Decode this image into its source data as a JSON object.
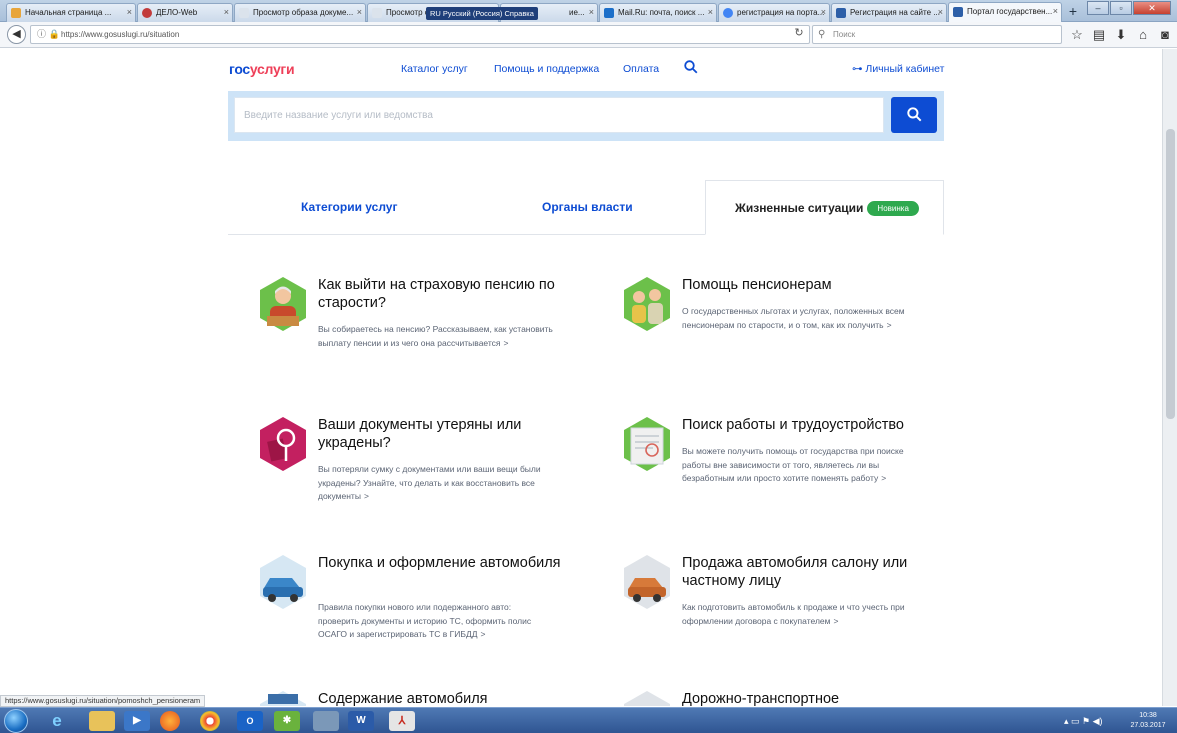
{
  "browser": {
    "tabs": [
      {
        "label": "Начальная страница ...",
        "fav_color": "#e8a53a"
      },
      {
        "label": "ДЕЛО-Web",
        "fav_color": "#c23b3b"
      },
      {
        "label": "Просмотр образа докуме...",
        "fav_color": "#dbe3ec"
      },
      {
        "label": "Просмотр обра",
        "fav_color": "#dbe3ec"
      },
      {
        "label": "ие...",
        "fav_color": "#dbe3ec"
      },
      {
        "label": "Mail.Ru: почта, поиск ...",
        "fav_color": "#1c6fc9"
      },
      {
        "label": "регистрация на порта...",
        "fav_color": "#4285f4"
      },
      {
        "label": "Регистрация на сайте ...",
        "fav_color": "#2d5fa8"
      },
      {
        "label": "Портал государствен...",
        "fav_color": "#2d5fa8"
      }
    ],
    "language_bar": "RU Русский (Россия)   Справка",
    "url": "https://www.gosuslugi.ru/situation",
    "search_placeholder": "Поиск",
    "status_url": "https://www.gosuslugi.ru/situation/pomoshch_pensioneram"
  },
  "header": {
    "logo_part1": "гос",
    "logo_part2": "услуги",
    "nav": [
      "Каталог услуг",
      "Помощь и поддержка",
      "Оплата"
    ],
    "cabinet": "Личный кабинет"
  },
  "search": {
    "placeholder": "Введите название услуги или ведомства"
  },
  "tabs": {
    "categories": "Категории услуг",
    "authorities": "Органы власти",
    "situations": "Жизненные ситуации",
    "badge": "Новинка"
  },
  "cards": [
    {
      "title": "Как выйти на страховую пенсию по старости?",
      "desc": "Вы собираетесь на пенсию? Рассказываем, как установить выплату пенсии и из чего она рассчитывается"
    },
    {
      "title": "Помощь пенсионерам",
      "desc": "О государственных льготах и услугах, положенных всем пенсионерам по старости, и о том, как их получить"
    },
    {
      "title": "Ваши документы утеряны или украдены?",
      "desc": "Вы потеряли сумку с документами или ваши вещи были украдены? Узнайте, что делать и как восстановить все документы"
    },
    {
      "title": "Поиск работы и трудоустройство",
      "desc": "Вы можете получить помощь от государства при поиске работы вне зависимости от того, являетесь ли вы безработным или просто хотите поменять работу"
    },
    {
      "title": "Покупка и оформление автомобиля",
      "desc": "Правила покупки нового или подержанного авто: проверить документы и историю ТС, оформить полис ОСАГО и зарегистрировать ТС в ГИБДД"
    },
    {
      "title": "Продажа автомобиля салону или частному лицу",
      "desc": "Как подготовить автомобиль к продаже и что учесть при оформлении договора с покупателем"
    },
    {
      "title": "Содержание автомобиля",
      "desc": ""
    },
    {
      "title": "Дорожно-транспортное",
      "desc": ""
    }
  ],
  "taskbar": {
    "time": "10:38",
    "date": "27.03.2017"
  }
}
